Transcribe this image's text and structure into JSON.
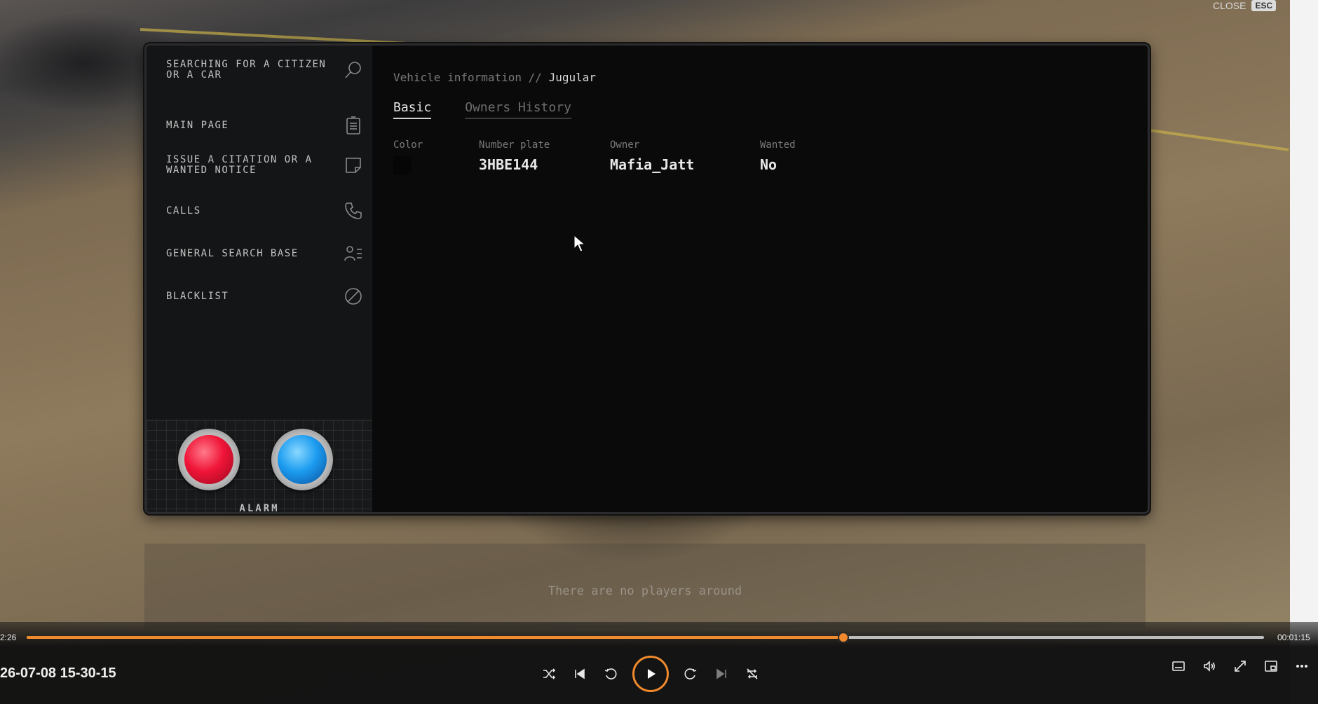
{
  "window": {
    "close_label": "CLOSE",
    "esc_key": "ESC"
  },
  "sidebar": {
    "items": [
      {
        "label": "SEARCHING FOR A CITIZEN OR A CAR",
        "icon": "search-icon"
      },
      {
        "label": "MAIN PAGE",
        "icon": "clipboard-icon"
      },
      {
        "label": "ISSUE A CITATION OR A WANTED NOTICE",
        "icon": "note-icon"
      },
      {
        "label": "CALLS",
        "icon": "phone-icon"
      },
      {
        "label": "GENERAL SEARCH BASE",
        "icon": "user-list-icon"
      },
      {
        "label": "BLACKLIST",
        "icon": "ban-icon"
      }
    ],
    "alarm": {
      "label": "ALARM",
      "red_color": "#f01438",
      "blue_color": "#1c9cf0"
    }
  },
  "content": {
    "breadcrumb_section": "Vehicle information //",
    "breadcrumb_current": "Jugular",
    "tabs": [
      {
        "label": "Basic",
        "active": true
      },
      {
        "label": "Owners History",
        "active": false
      }
    ],
    "fields": {
      "color_label": "Color",
      "color_value": "#060606",
      "plate_label": "Number plate",
      "plate_value": "3HBE144",
      "owner_label": "Owner",
      "owner_value": "Mafia_Jatt",
      "wanted_label": "Wanted",
      "wanted_value": "No"
    }
  },
  "players_hint": "There are no players around",
  "player": {
    "elapsed": "2:26",
    "remaining": "00:01:15",
    "progress_fraction": 0.66,
    "filename": "26-07-08 15-30-15",
    "accent": "#f08a2c"
  }
}
